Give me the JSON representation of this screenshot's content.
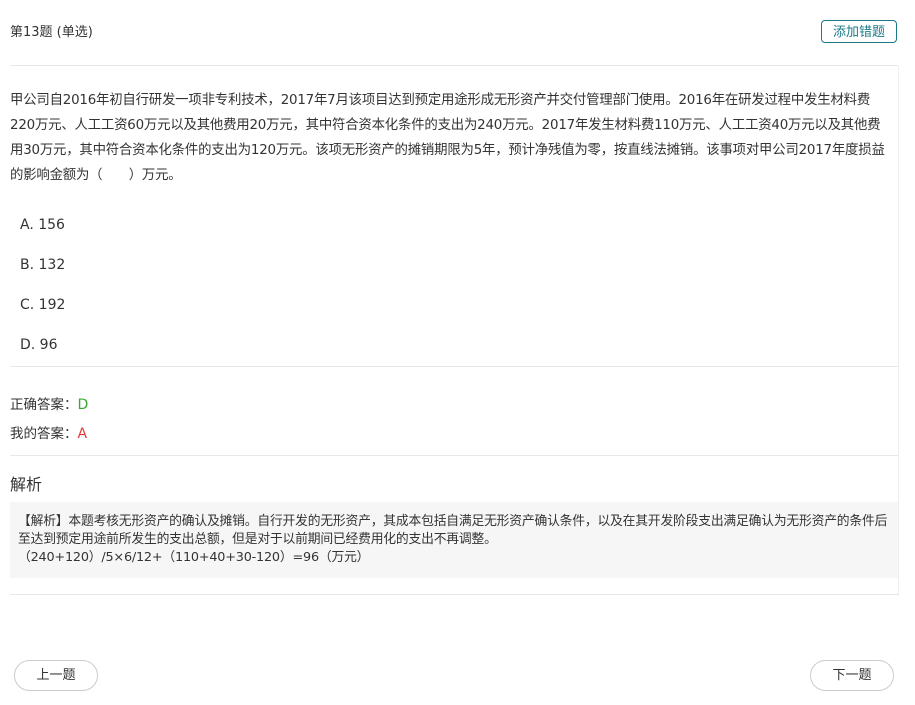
{
  "question": {
    "header": "第13题 (单选)",
    "add_wrong_label": "添加错题",
    "stem": "甲公司自2016年初自行研发一项非专利技术，2017年7月该项目达到预定用途形成无形资产并交付管理部门使用。2016年在研发过程中发生材料费220万元、人工工资60万元以及其他费用20万元，其中符合资本化条件的支出为240万元。2017年发生材料费110万元、人工工资40万元以及其他费用30万元，其中符合资本化条件的支出为120万元。该项无形资产的摊销期限为5年，预计净残值为零，按直线法摊销。该事项对甲公司2017年度损益的影响金额为（　　）万元。",
    "options": [
      {
        "label": "A. 156"
      },
      {
        "label": "B. 132"
      },
      {
        "label": "C. 192"
      },
      {
        "label": "D. 96"
      }
    ]
  },
  "answers": {
    "correct_label": "正确答案：",
    "correct_value": "D",
    "mine_label": "我的答案：",
    "mine_value": "A"
  },
  "analysis": {
    "title": "解析",
    "line1": "【解析】本题考核无形资产的确认及摊销。自行开发的无形资产，其成本包括自满足无形资产确认条件，以及在其开发阶段支出满足确认为无形资产的条件后至达到预定用途前所发生的支出总额，但是对于以前期间已经费用化的支出不再调整。",
    "line2": "（240+120）/5×6/12+（110+40+30-120）=96（万元）"
  },
  "nav": {
    "prev_label": "上一题",
    "next_label": "下一题"
  },
  "colors": {
    "accent": "#1a7a8a",
    "correct": "#3aaa35",
    "wrong": "#e03a3a"
  }
}
